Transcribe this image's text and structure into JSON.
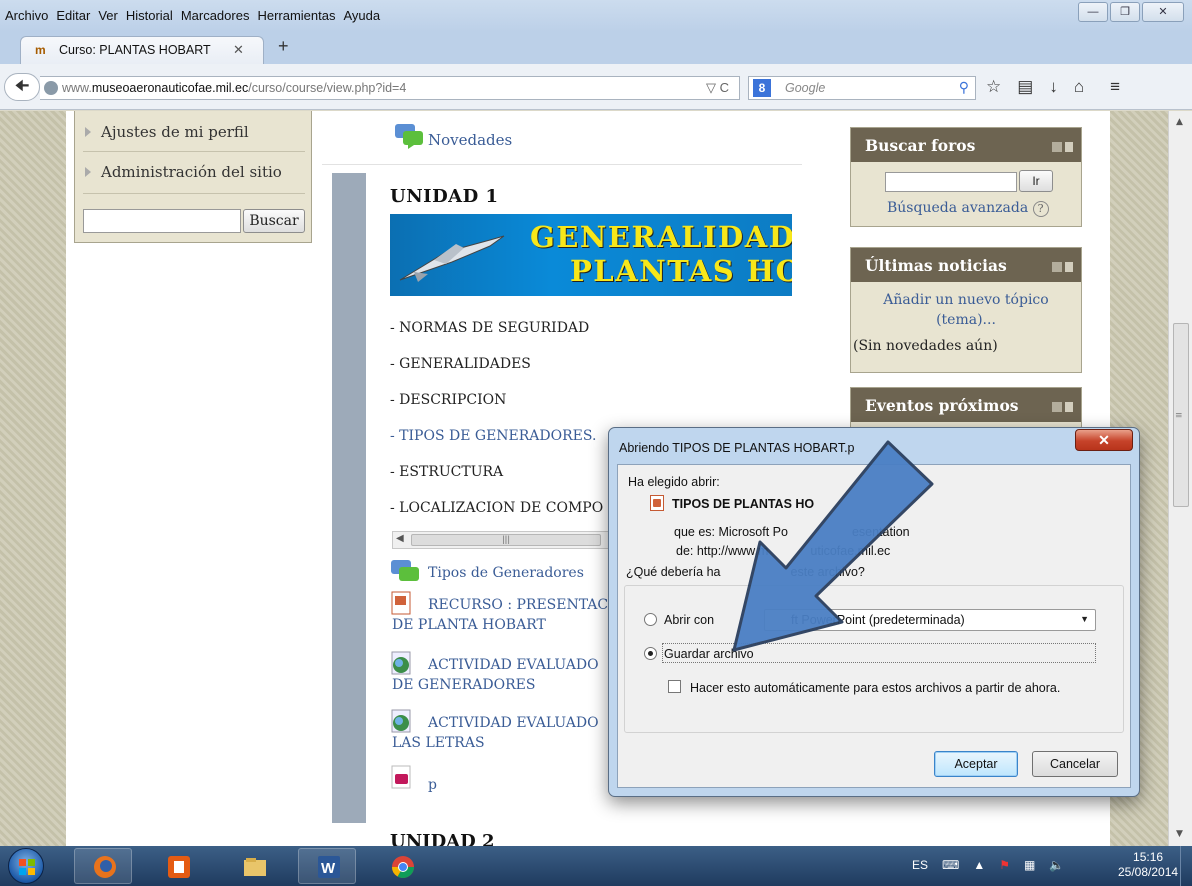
{
  "browser": {
    "menu": [
      "Archivo",
      "Editar",
      "Ver",
      "Historial",
      "Marcadores",
      "Herramientas",
      "Ayuda"
    ],
    "tab_title": "Curso: PLANTAS HOBART",
    "tab_icon_text": "m",
    "url_gray_prefix": "www.",
    "url_host": "museoaeronauticofae.mil.ec",
    "url_path": "/curso/course/view.php?id=4",
    "search_engine_letter": "8",
    "search_placeholder": "Google"
  },
  "left_block": {
    "items": [
      "Ajustes de mi perfil",
      "Administración del sitio"
    ],
    "search_button": "Buscar"
  },
  "main": {
    "novedades": "Novedades",
    "unit_title": "UNIDAD 1",
    "banner_line1": "GENERALIDADES D",
    "banner_line2": "PLANTAS HOBA",
    "topics": [
      "- NORMAS DE SEGURIDAD",
      "- GENERALIDADES",
      "- DESCRIPCION",
      "- TIPOS DE GENERADORES.",
      "- ESTRUCTURA",
      "- LOCALIZACION DE COMPO"
    ],
    "activities": [
      {
        "line1": "Tipos de Generadores",
        "line2": ""
      },
      {
        "line1": "RECURSO : PRESENTAC",
        "line2": "DE PLANTA HOBART"
      },
      {
        "line1": "ACTIVIDAD EVALUADO",
        "line2": "DE GENERADORES"
      },
      {
        "line1": "ACTIVIDAD EVALUADO",
        "line2": "LAS LETRAS"
      },
      {
        "line1": "p",
        "line2": ""
      }
    ],
    "unit2_title": "UNIDAD 2"
  },
  "right_blocks": {
    "buscar_foros": {
      "title": "Buscar foros",
      "button": "Ir",
      "link": "Búsqueda avanzada"
    },
    "ultimas_noticias": {
      "title": "Últimas noticias",
      "link_line1": "Añadir un nuevo tópico",
      "link_line2": "(tema)...",
      "status": "(Sin novedades aún)"
    },
    "eventos": {
      "title": "Eventos próximos"
    }
  },
  "dialog": {
    "title": "Abriendo TIPOS DE PLANTAS HOBART.p",
    "chose_label": "Ha elegido abrir:",
    "filename": "TIPOS DE PLANTAS HO",
    "type_label": "que es:  Microsoft Po",
    "type_suffix": "esentation",
    "from_label": "de:  http://www.m",
    "from_suffix": "uticofae.mil.ec",
    "question_prefix": "¿Qué debería ha",
    "question_suffix": "este archivo?",
    "open_with_label": "Abrir con",
    "open_with_value": "ft PowerPoint (predeterminada)",
    "save_label": "Guardar archivo",
    "auto_label": "Hacer esto automáticamente para estos archivos a partir de ahora.",
    "accept": "Aceptar",
    "cancel": "Cancelar"
  },
  "taskbar": {
    "language": "ES",
    "time": "15:16",
    "date": "25/08/2014"
  },
  "colors": {
    "link": "#3a5c96",
    "block_header": "#6d6451",
    "block_body": "#e8e4d1",
    "banner_text": "#f7e71a",
    "arrow": "#4a7fc4"
  }
}
